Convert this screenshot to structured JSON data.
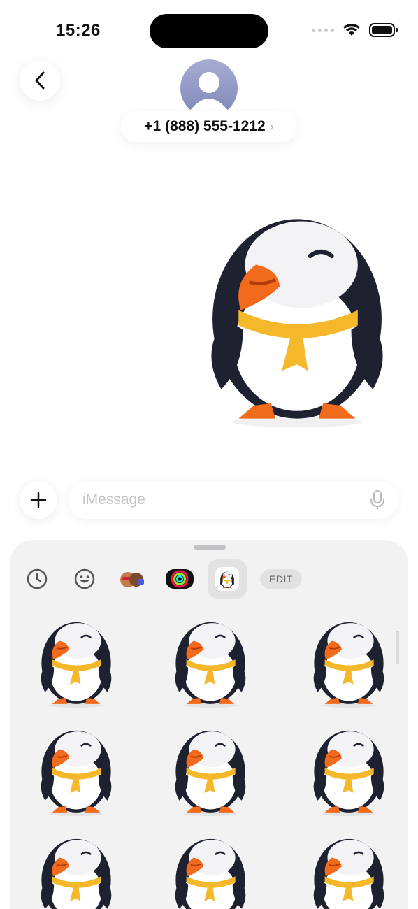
{
  "status_bar": {
    "time": "15:26"
  },
  "header": {
    "contact": "+1 (888) 555-1212",
    "chevron": "›"
  },
  "compose": {
    "placeholder": "iMessage"
  },
  "drawer": {
    "tabs": [
      {
        "name": "recents-icon",
        "selected": false
      },
      {
        "name": "emoji-icon",
        "selected": false
      },
      {
        "name": "memoji-icon",
        "selected": false
      },
      {
        "name": "activity-rings-icon",
        "selected": false
      },
      {
        "name": "puffin-sticker-pack-icon",
        "selected": true
      }
    ],
    "edit_label": "EDIT"
  },
  "colors": {
    "accent_orange": "#f26a1b",
    "scarf_yellow": "#f5b82a",
    "puffin_black": "#1e2230",
    "drawer_bg": "#f2f2f2"
  }
}
